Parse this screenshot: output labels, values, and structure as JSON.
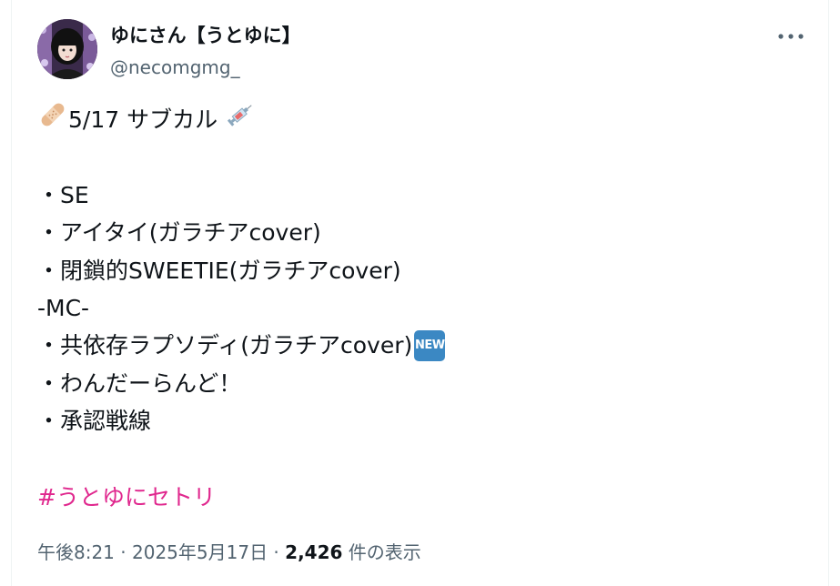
{
  "user": {
    "display_name": "ゆにさん【うとゆに】",
    "handle": "@necomgmg_",
    "avatar_icon": "avatar-photo"
  },
  "menu": {
    "icon": "more-options-icon"
  },
  "tweet": {
    "title_text": "5/17 サブカル",
    "title_emoji_left": "bandage-emoji",
    "title_emoji_right": "syringe-emoji",
    "setlist": [
      "・SE",
      "・アイタイ(ガラチアcover)",
      "・閉鎖的SWEETIE(ガラチアcover)",
      "-MC-",
      "・共依存ラプソディ(ガラチアcover)",
      "・わんだーらんど！",
      "・承認戦線"
    ],
    "new_badge": "NEW",
    "hashtag": "#うとゆにセトリ"
  },
  "meta": {
    "time": "午後8:21",
    "separator1": " · ",
    "date": "2025年5月17日",
    "separator2": " · ",
    "views_count": "2,426",
    "views_label": " 件の表示"
  },
  "colors": {
    "hashtag": "#e0288e",
    "secondary_text": "#536471",
    "primary_text": "#0f1419"
  }
}
